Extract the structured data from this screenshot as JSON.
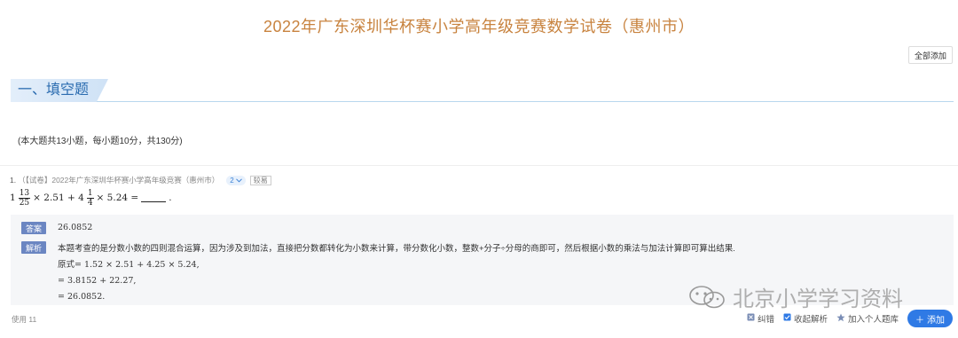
{
  "title": "2022年广东深圳华杯赛小学高年级竞赛数学试卷（惠州市）",
  "add_all_label": "全部添加",
  "section": {
    "heading": "一、填空题",
    "note": "(本大题共13小题，每小题10分，共130分)"
  },
  "question": {
    "number": "1.",
    "source": "（【试卷】2022年广东深圳华杯赛小学高年级竞赛（惠州市）",
    "score": "2",
    "difficulty": "较易",
    "formula": {
      "whole1": "1",
      "num1": "13",
      "den1": "25",
      "part1": "× 2.51 + 4",
      "num2": "1",
      "den2": "4",
      "part2": "× 5.24 =",
      "end": "."
    },
    "answer_tag": "答案",
    "answer": "26.0852",
    "analysis_tag": "解析",
    "analysis_lines": [
      "本题考查的是分数小数的四则混合运算，因为涉及到加法，直接把分数都转化为小数来计算，带分数化小数，整数+分子÷分母的商即可，然后根据小数的乘法与加法计算即可算出结果.",
      "原式= 1.52 × 2.51 + 4.25 × 5.24,",
      "= 3.8152 + 22.27,",
      "= 26.0852."
    ],
    "usage": "使用 11"
  },
  "actions": {
    "error": "纠错",
    "collect": "收起解析",
    "add_personal": "加入个人题库",
    "add": "添加"
  },
  "watermark": "北京小学学习资料",
  "colors": {
    "title": "#c8833f",
    "accent": "#2f7ae5",
    "tag": "#6b86c2"
  }
}
